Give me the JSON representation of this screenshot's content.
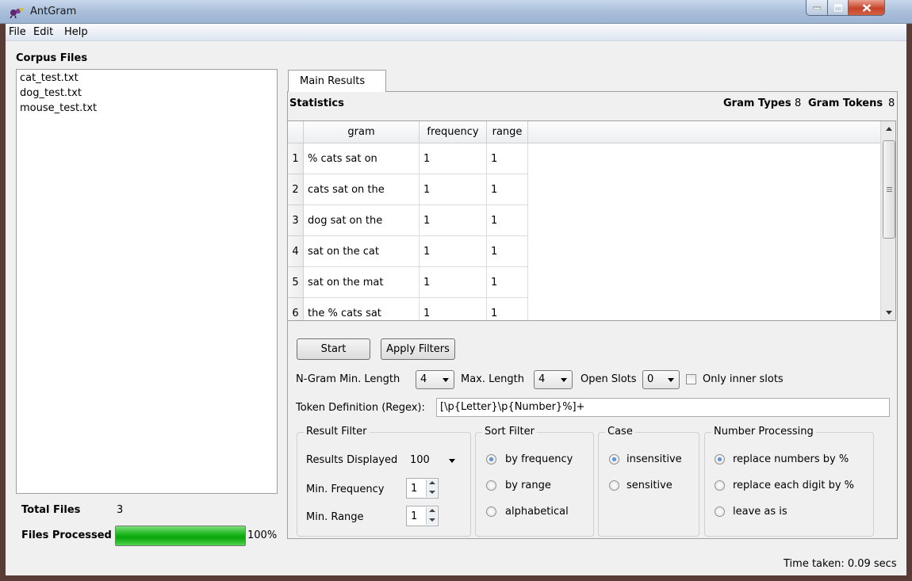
{
  "window": {
    "title": "AntGram"
  },
  "menu": [
    "File",
    "Edit",
    "Help"
  ],
  "corpus": {
    "heading": "Corpus Files",
    "files": [
      "cat_test.txt",
      "dog_test.txt",
      "mouse_test.txt"
    ],
    "total_label": "Total Files",
    "total_value": "3",
    "processed_label": "Files Processed",
    "progress_percent": 100,
    "progress_text": "100%"
  },
  "tabs": [
    "Main Results"
  ],
  "stats": {
    "label": "Statistics",
    "gram_types_label": "Gram Types",
    "gram_types_value": "8",
    "gram_tokens_label": "Gram Tokens",
    "gram_tokens_value": "8"
  },
  "table": {
    "columns": [
      "gram",
      "frequency",
      "range"
    ],
    "rows": [
      {
        "n": "1",
        "gram": "% cats sat on",
        "frequency": "1",
        "range": "1"
      },
      {
        "n": "2",
        "gram": "cats sat on the",
        "frequency": "1",
        "range": "1"
      },
      {
        "n": "3",
        "gram": "dog sat on the",
        "frequency": "1",
        "range": "1"
      },
      {
        "n": "4",
        "gram": "sat on the cat",
        "frequency": "1",
        "range": "1"
      },
      {
        "n": "5",
        "gram": "sat on the mat",
        "frequency": "1",
        "range": "1"
      },
      {
        "n": "6",
        "gram": "the % cats sat",
        "frequency": "1",
        "range": "1"
      }
    ]
  },
  "controls": {
    "start_label": "Start",
    "apply_label": "Apply Filters",
    "ngram_min_label": "N-Gram Min. Length",
    "ngram_min_value": "4",
    "max_length_label": "Max. Length",
    "max_length_value": "4",
    "open_slots_label": "Open Slots",
    "open_slots_value": "0",
    "inner_slots_label": "Only inner slots",
    "token_def_label": "Token Definition (Regex):",
    "token_def_value": "[\\p{Letter}\\p{Number}%]+"
  },
  "result_filter": {
    "title": "Result Filter",
    "results_displayed_label": "Results Displayed",
    "results_displayed_value": "100",
    "min_frequency_label": "Min. Frequency",
    "min_frequency_value": "1",
    "min_range_label": "Min. Range",
    "min_range_value": "1"
  },
  "sort_filter": {
    "title": "Sort Filter",
    "options": [
      "by frequency",
      "by range",
      "alphabetical"
    ],
    "selected": 0
  },
  "case": {
    "title": "Case",
    "options": [
      "insensitive",
      "sensitive"
    ],
    "selected": 0
  },
  "number_processing": {
    "title": "Number Processing",
    "options": [
      "replace numbers by %",
      "replace each digit by %",
      "leave as is"
    ],
    "selected": 0
  },
  "status": {
    "time_taken": "Time taken: 0.09 secs"
  },
  "colors": {
    "progress": "#16b216",
    "title_bar": "#a9bfdb",
    "close_button": "#c5442a"
  }
}
